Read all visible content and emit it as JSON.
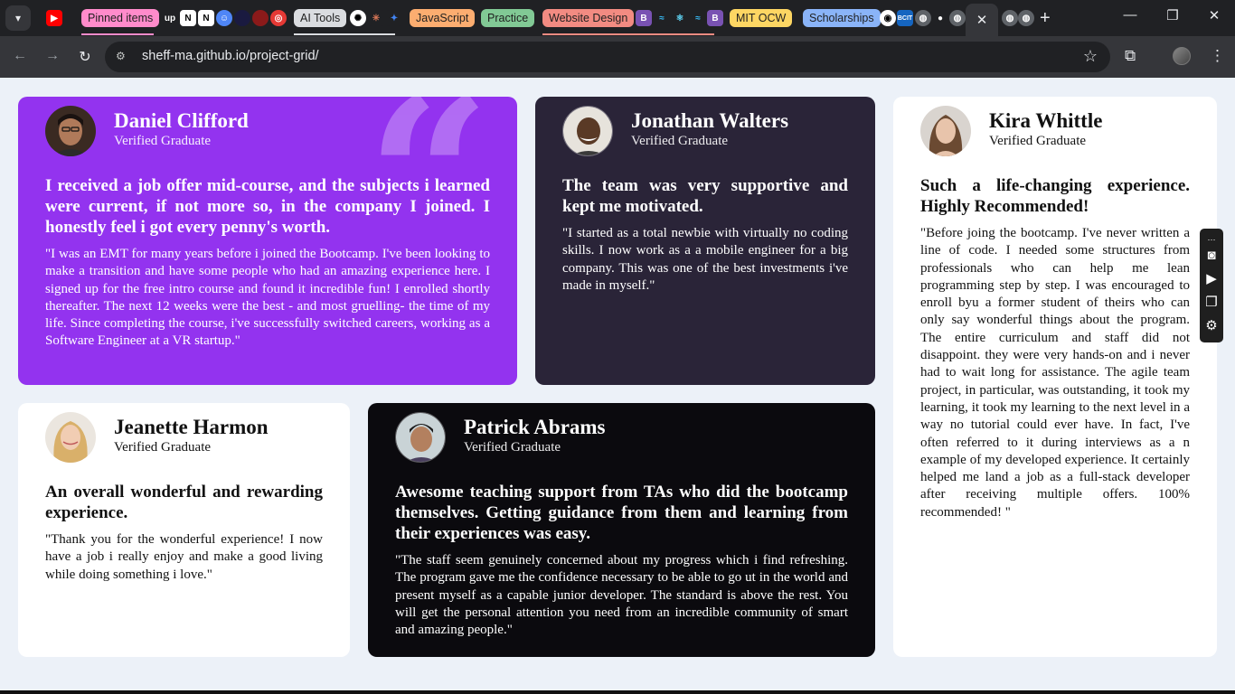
{
  "browser": {
    "url": "sheff-ma.github.io/project-grid/",
    "tab_groups": [
      {
        "label": "Pinned items",
        "color": "#ff8bcb"
      },
      {
        "label": "AI Tools",
        "color": "#dadce0"
      },
      {
        "label": "JavaScript",
        "color": "#fcad70"
      },
      {
        "label": "Practice",
        "color": "#81c995"
      },
      {
        "label": "Website Design",
        "color": "#f28b82"
      },
      {
        "label": "MIT OCW",
        "color": "#fdd663"
      },
      {
        "label": "Scholarships",
        "color": "#8ab4f8"
      }
    ]
  },
  "testimonials": [
    {
      "name": "Daniel Clifford",
      "role": "Verified Graduate",
      "headline": "I received a job offer mid-course, and the subjects i learned were current, if not more so, in the company I joined. I honestly feel i got every penny's worth.",
      "body": "\"I was an EMT for many years before i joined the Bootcamp. I've been looking to make a transition and have some people who had an amazing experience here. I signed up for the free intro course and found it incredible fun! I enrolled shortly thereafter. The next 12 weeks were the best - and most gruelling- the time of my life. Since completing the course, i've successfully switched careers, working as a Software Engineer at a VR startup.\"",
      "theme": "#9333ef"
    },
    {
      "name": "Jonathan Walters",
      "role": "Verified Graduate",
      "headline": "The team was very supportive and kept me motivated.",
      "body": "\"I started as a total newbie with virtually no coding skills. I now work as a a mobile engineer for a big company. This was one of the best investments i've made in myself.\"",
      "theme": "#2a2438"
    },
    {
      "name": "Kira Whittle",
      "role": "Verified Graduate",
      "headline": "Such a life-changing experience. Highly Recommended!",
      "body": "\"Before joing the bootcamp. I've never written a line of code. I needed some structures from professionals who can help me lean programming step by step. I was encouraged to enroll byu a former student of theirs who can only say wonderful things about the program. The entire curriculum and staff did not disappoint. they were very hands-on and i never had to wait long for assistance. The agile team project, in particular, was outstanding, it took my learning, it took my learning to the next level in a way no tutorial could ever have. In fact, I've often referred to it during interviews as a n example of my developed experience. It certainly helped me land a job as a full-stack developer after receiving multiple offers. 100% recommended! \"",
      "theme": "#ffffff"
    },
    {
      "name": "Jeanette Harmon",
      "role": "Verified Graduate",
      "headline": "An overall wonderful and rewarding experience.",
      "body": "\"Thank you for the wonderful experience! I now have a job i really enjoy and make a good living while doing something i love.\"",
      "theme": "#ffffff"
    },
    {
      "name": "Patrick Abrams",
      "role": "Verified Graduate",
      "headline": "Awesome teaching support from TAs who did the bootcamp themselves. Getting guidance from them and learning from their experiences was easy.",
      "body": "\"The staff seem genuinely concerned about my progress which i find refreshing. The program gave me the confidence necessary to be able to go ut in the world and present myself as a capable junior developer. The standard is above the rest. You will get the personal attention you need from an incredible community of smart and amazing people.\"",
      "theme": "#0b0a0e"
    }
  ]
}
